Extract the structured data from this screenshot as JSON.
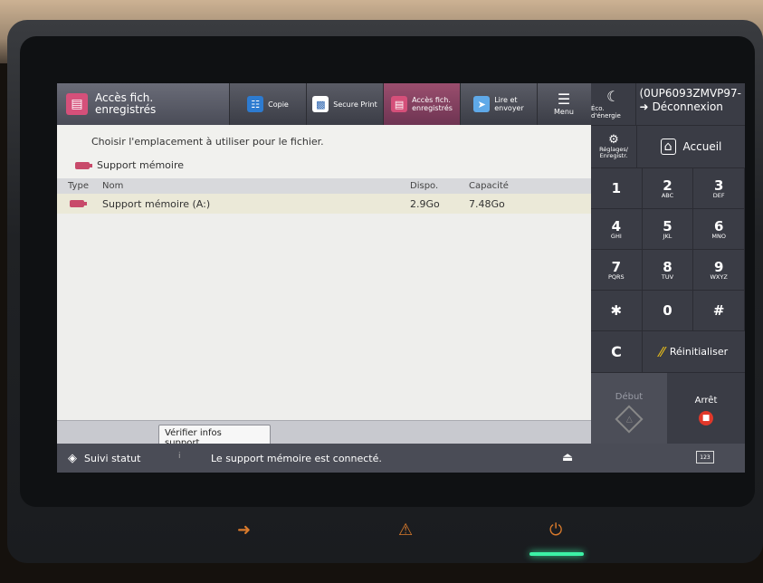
{
  "topbar": {
    "current_app": "Accès fich.\nenregistrés",
    "tabs": [
      {
        "label": "Copie",
        "icon": "copy-icon"
      },
      {
        "label": "Secure Print",
        "icon": "lock-print-icon"
      },
      {
        "label": "Accès fich.\nenregistrés",
        "icon": "stored-files-icon"
      },
      {
        "label": "Lire et\nenvoyer",
        "icon": "scan-send-icon"
      },
      {
        "label": "Menu",
        "icon": "menu-icon"
      }
    ]
  },
  "right_panel": {
    "eco_label": "Éco. d'énergie",
    "user_id": "(0UP6093ZMVP97-",
    "logout_label": "Déconnexion",
    "settings_label": "Réglages/\nEnregistr.",
    "home_label": "Accueil",
    "keys": [
      {
        "digit": "1",
        "letters": ""
      },
      {
        "digit": "2",
        "letters": "ABC"
      },
      {
        "digit": "3",
        "letters": "DEF"
      },
      {
        "digit": "4",
        "letters": "GHI"
      },
      {
        "digit": "5",
        "letters": "JKL"
      },
      {
        "digit": "6",
        "letters": "MNO"
      },
      {
        "digit": "7",
        "letters": "PQRS"
      },
      {
        "digit": "8",
        "letters": "TUV"
      },
      {
        "digit": "9",
        "letters": "WXYZ"
      },
      {
        "digit": "✱",
        "letters": ""
      },
      {
        "digit": "0",
        "letters": ""
      },
      {
        "digit": "#",
        "letters": ""
      }
    ],
    "clear_key": "C",
    "reset_label": "Réinitialiser",
    "start_label": "Début",
    "stop_label": "Arrêt"
  },
  "content": {
    "instruction": "Choisir l'emplacement à utiliser pour le fichier.",
    "location": "Support mémoire",
    "columns": {
      "type": "Type",
      "name": "Nom",
      "available": "Dispo.",
      "capacity": "Capacité"
    },
    "rows": [
      {
        "type_icon": "usb-icon",
        "name": "Support mémoire (A:)",
        "available": "2.9Go",
        "capacity": "7.48Go"
      }
    ],
    "verify_button": "Vérifier infos\nsupport"
  },
  "status": {
    "monitor_label": "Suivi statut",
    "message": "Le support mémoire est connecté."
  }
}
